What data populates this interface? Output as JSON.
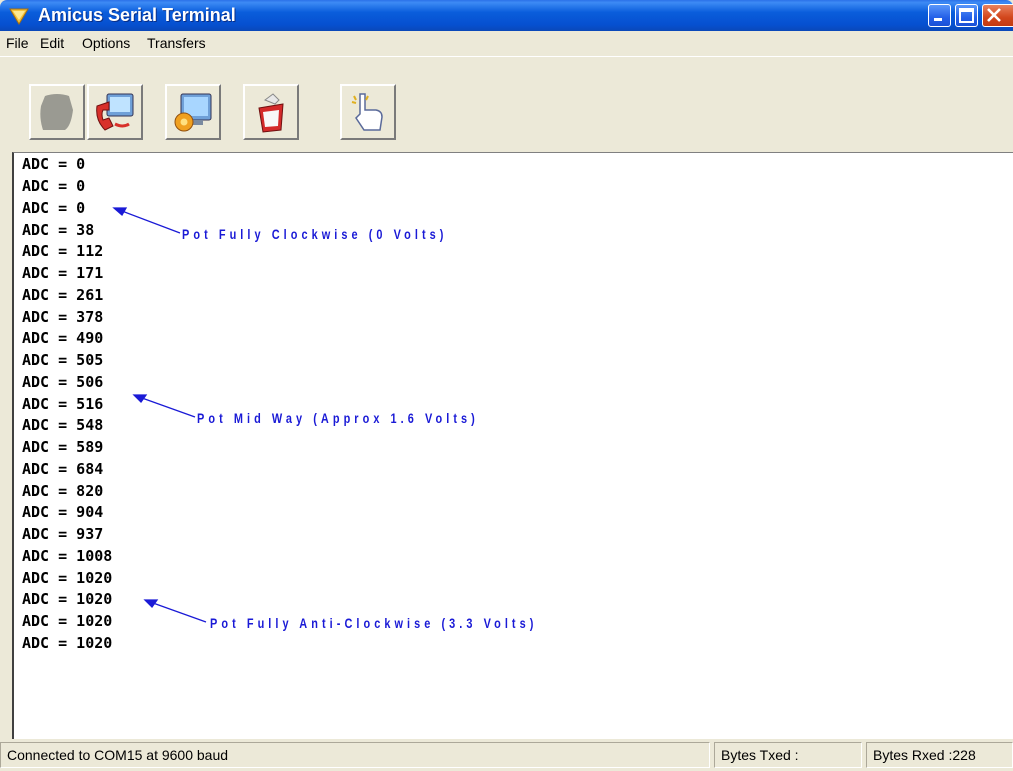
{
  "window": {
    "title": "Amicus Serial Terminal"
  },
  "menu": {
    "items": [
      "File",
      "Edit",
      "Options",
      "Transfers"
    ]
  },
  "toolbar": {
    "buttons": [
      {
        "icon": "disabled-blank-icon"
      },
      {
        "icon": "phone-connect-icon"
      },
      {
        "icon": "monitor-settings-icon"
      },
      {
        "icon": "clear-screen-icon"
      },
      {
        "icon": "pointing-hand-icon"
      }
    ]
  },
  "terminal": {
    "lines": [
      "ADC = 0",
      "ADC = 0",
      "ADC = 0",
      "ADC = 38",
      "ADC = 112",
      "ADC = 171",
      "ADC = 261",
      "ADC = 378",
      "ADC = 490",
      "ADC = 505",
      "ADC = 506",
      "ADC = 516",
      "ADC = 548",
      "ADC = 589",
      "ADC = 684",
      "ADC = 820",
      "ADC = 904",
      "ADC = 937",
      "ADC = 1008",
      "ADC = 1020",
      "ADC = 1020",
      "ADC = 1020",
      "ADC = 1020"
    ]
  },
  "annotations": [
    {
      "text": "Pot Fully Clockwise (0 Volts)"
    },
    {
      "text": "Pot Mid Way (Approx 1.6 Volts)"
    },
    {
      "text": "Pot Fully Anti-Clockwise (3.3 Volts)"
    }
  ],
  "status": {
    "connection": "Connected to COM15 at 9600 baud",
    "bytes_txed": "Bytes Txed :",
    "bytes_rxed": "Bytes Rxed :228"
  },
  "colors": {
    "titlebar": "#0a5ddb",
    "annotation": "#1a1ad6",
    "terminal_bg": "#ffffff"
  }
}
